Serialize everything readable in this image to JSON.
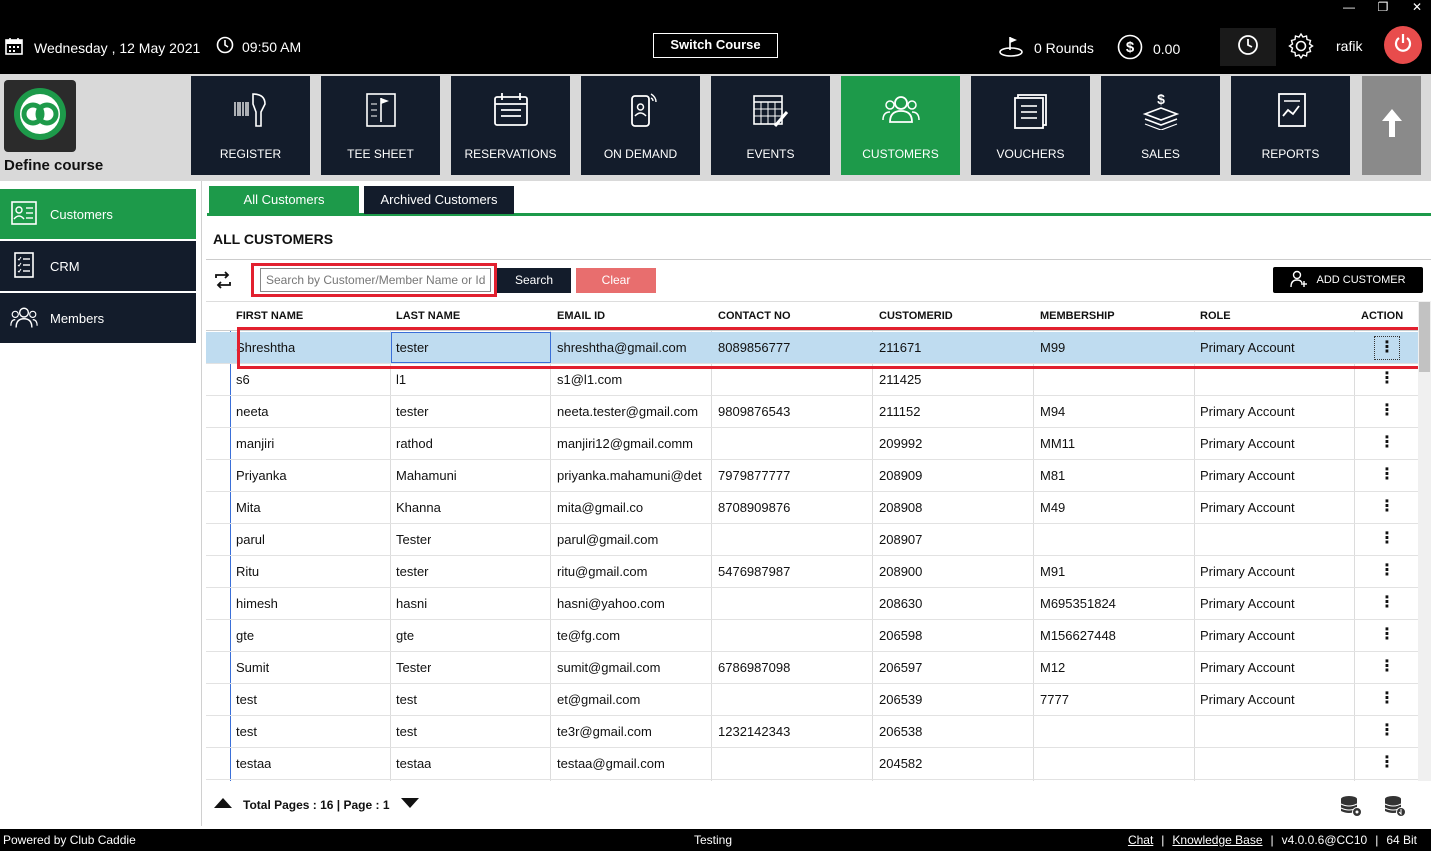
{
  "window": {
    "minimize": "—",
    "restore": "❐",
    "close": "✕"
  },
  "topbar": {
    "date": "Wednesday ,  12 May 2021",
    "time": "09:50 AM",
    "switch_course": "Switch Course",
    "rounds": "0 Rounds",
    "balance": "0.00",
    "user": "rafik"
  },
  "course": {
    "name": "Define course"
  },
  "modules": [
    {
      "label": "REGISTER",
      "icon": "barcode-scanner-icon",
      "active": false
    },
    {
      "label": "TEE SHEET",
      "icon": "tee-sheet-icon",
      "active": false
    },
    {
      "label": "RESERVATIONS",
      "icon": "calendar-icon",
      "active": false
    },
    {
      "label": "ON DEMAND",
      "icon": "mobile-icon",
      "active": false
    },
    {
      "label": "EVENTS",
      "icon": "events-calendar-icon",
      "active": false
    },
    {
      "label": "CUSTOMERS",
      "icon": "people-icon",
      "active": true
    },
    {
      "label": "VOUCHERS",
      "icon": "voucher-icon",
      "active": false
    },
    {
      "label": "SALES",
      "icon": "money-stack-icon",
      "active": false
    },
    {
      "label": "REPORTS",
      "icon": "report-icon",
      "active": false
    }
  ],
  "sidebar": {
    "items": [
      {
        "label": "Customers",
        "icon": "id-card-icon",
        "active": true
      },
      {
        "label": "CRM",
        "icon": "checklist-icon",
        "active": false
      },
      {
        "label": "Members",
        "icon": "members-icon",
        "active": false
      }
    ]
  },
  "tabs": {
    "all": "All Customers",
    "archived": "Archived Customers"
  },
  "section_title": "ALL CUSTOMERS",
  "search": {
    "placeholder": "Search by Customer/Member Name or Id",
    "button": "Search",
    "clear": "Clear"
  },
  "add_customer": "ADD CUSTOMER",
  "grid": {
    "columns": [
      "FIRST NAME",
      "LAST NAME",
      "EMAIL ID",
      "CONTACT NO",
      "CUSTOMERID",
      "MEMBERSHIP",
      "ROLE",
      "ACTION"
    ],
    "rows": [
      [
        "Shreshtha",
        "tester",
        "shreshtha@gmail.com",
        "8089856777",
        "211671",
        "M99",
        "Primary Account"
      ],
      [
        "s6",
        "l1",
        "s1@l1.com",
        "",
        "211425",
        "",
        ""
      ],
      [
        "neeta",
        "tester",
        "neeta.tester@gmail.com",
        "9809876543",
        "211152",
        "M94",
        "Primary Account"
      ],
      [
        "manjiri",
        "rathod",
        "manjiri12@gmail.comm",
        "",
        "209992",
        "MM11",
        "Primary Account"
      ],
      [
        "Priyanka",
        "Mahamuni",
        "priyanka.mahamuni@det",
        "7979877777",
        "208909",
        "M81",
        "Primary Account"
      ],
      [
        "Mita",
        "Khanna",
        "mita@gmail.co",
        "8708909876",
        "208908",
        "M49",
        "Primary Account"
      ],
      [
        "parul",
        "Tester",
        "parul@gmail.com",
        "",
        "208907",
        "",
        ""
      ],
      [
        "Ritu",
        "tester",
        "ritu@gmail.com",
        "5476987987",
        "208900",
        "M91",
        "Primary Account"
      ],
      [
        "himesh",
        "hasni",
        "hasni@yahoo.com",
        "",
        "208630",
        "M695351824",
        "Primary Account"
      ],
      [
        "gte",
        "gte",
        "te@fg.com",
        "",
        "206598",
        "M156627448",
        "Primary Account"
      ],
      [
        "Sumit",
        "Tester",
        "sumit@gmail.com",
        "6786987098",
        "206597",
        "M12",
        "Primary Account"
      ],
      [
        "test",
        "test",
        "et@gmail.com",
        "",
        "206539",
        "7777",
        "Primary Account"
      ],
      [
        "test",
        "test",
        "te3r@gmail.com",
        "1232142343",
        "206538",
        "",
        ""
      ],
      [
        "testaa",
        "testaa",
        "testaa@gmail.com",
        "",
        "204582",
        "",
        ""
      ]
    ],
    "action_glyph": "⋮"
  },
  "pager": {
    "text": "Total Pages : 16 | Page : 1"
  },
  "footer": {
    "powered": "Powered by Club Caddie",
    "env": "Testing",
    "chat": "Chat",
    "sep1": "|",
    "kb": "Knowledge Base",
    "sep2": "|",
    "version": "v4.0.0.6@CC10",
    "sep3": "|",
    "bits": "64 Bit"
  },
  "colors": {
    "accent": "#1d9a4a",
    "navy": "#131c2b",
    "highlight": "#e2202f",
    "selected_row": "#bfdcf0",
    "clear": "#e86e6e"
  }
}
